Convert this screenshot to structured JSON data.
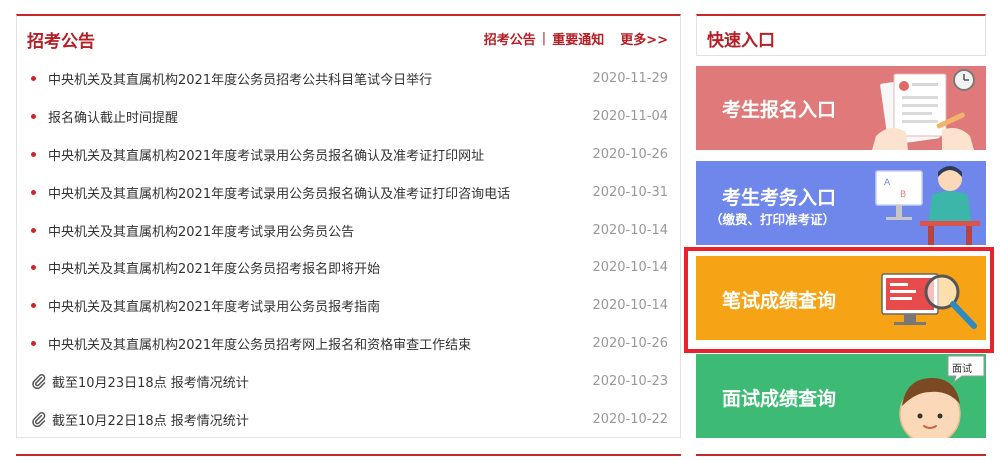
{
  "notice": {
    "title": "招考公告",
    "links": [
      "招考公告",
      "重要通知"
    ],
    "separator": "|",
    "more": "更多>>",
    "items": [
      {
        "title": "中央机关及其直属机构2021年度公务员招考公共科目笔试今日举行",
        "date": "2020-11-29",
        "icon": "bullet"
      },
      {
        "title": "报名确认截止时间提醒",
        "date": "2020-11-04",
        "icon": "bullet"
      },
      {
        "title": "中央机关及其直属机构2021年度考试录用公务员报名确认及准考证打印网址",
        "date": "2020-10-26",
        "icon": "bullet"
      },
      {
        "title": "中央机关及其直属机构2021年度考试录用公务员报名确认及准考证打印咨询电话",
        "date": "2020-10-31",
        "icon": "bullet"
      },
      {
        "title": "中央机关及其直属机构2021年度考试录用公务员公告",
        "date": "2020-10-14",
        "icon": "bullet"
      },
      {
        "title": "中央机关及其直属机构2021年度公务员招考报名即将开始",
        "date": "2020-10-14",
        "icon": "bullet"
      },
      {
        "title": "中央机关及其直属机构2021年度考试录用公务员报考指南",
        "date": "2020-10-14",
        "icon": "bullet"
      },
      {
        "title": "中央机关及其直属机构2021年度公务员招考网上报名和资格审查工作结束",
        "date": "2020-10-26",
        "icon": "bullet"
      },
      {
        "title": "截至10月23日18点 报考情况统计",
        "date": "2020-10-23",
        "icon": "paperclip-icon"
      },
      {
        "title": "截至10月22日18点 报考情况统计",
        "date": "2020-10-22",
        "icon": "paperclip-icon"
      }
    ]
  },
  "quick": {
    "title": "快速入口",
    "entries": [
      {
        "label": "考生报名入口",
        "sub": "",
        "color": "#e07a7a"
      },
      {
        "label": "考生考务入口",
        "sub": "（缴费、打印准考证）",
        "color": "#6f86ea"
      },
      {
        "label": "笔试成绩查询",
        "sub": "",
        "color": "#f6a316"
      },
      {
        "label": "面试成绩查询",
        "sub": "",
        "color": "#3dbb74",
        "badge": "面试"
      }
    ]
  },
  "colors": {
    "accent": "#c9272d",
    "highlight": "#e8232b",
    "date": "#999999"
  }
}
